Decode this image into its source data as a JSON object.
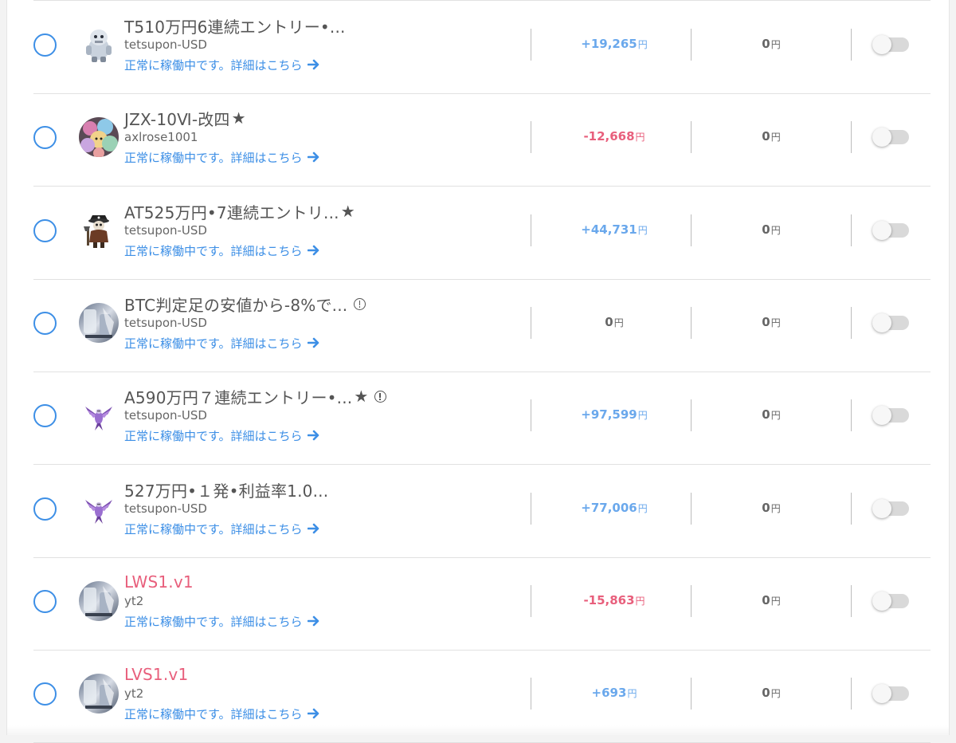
{
  "currency_unit": "円",
  "colors": {
    "accent_blue": "#3d8fe6",
    "profit_positive": "#6aa8ec",
    "profit_negative": "#e85f7c",
    "text_gray": "#555555"
  },
  "rows": [
    {
      "title": "T510万円6連続エントリー•...",
      "title_color": "gray",
      "star": false,
      "warning": false,
      "account": "tetsupon-USD",
      "status": "正常に稼働中です。詳細はこちら",
      "avatar_icon": "yeti-character-avatar",
      "profit": "+19,265",
      "profit_sign": "positive",
      "second_value": "0",
      "toggle_on": false
    },
    {
      "title": "JZX-10Ⅵ-改四",
      "title_color": "gray",
      "star": true,
      "warning": false,
      "account": "axlrose1001",
      "status": "正常に稼働中です。詳細はこちら",
      "avatar_icon": "plush-toys-photo-avatar",
      "profit": "-12,668",
      "profit_sign": "negative",
      "second_value": "0",
      "toggle_on": false
    },
    {
      "title": "AT525万円•7連続エントリ...",
      "title_color": "gray",
      "star": true,
      "warning": false,
      "account": "tetsupon-USD",
      "status": "正常に稼働中です。詳細はこちら",
      "avatar_icon": "pirate-skeleton-avatar",
      "profit": "+44,731",
      "profit_sign": "positive",
      "second_value": "0",
      "toggle_on": false
    },
    {
      "title": "BTC判定足の安値から-8%で...",
      "title_color": "gray",
      "star": false,
      "warning": true,
      "account": "tetsupon-USD",
      "status": "正常に稼働中です。詳細はこちら",
      "avatar_icon": "silver-device-photo-avatar",
      "profit": "0",
      "profit_sign": "zero",
      "second_value": "0",
      "toggle_on": false
    },
    {
      "title": "A590万円７連続エントリー•...",
      "title_color": "gray",
      "star": true,
      "warning": true,
      "account": "tetsupon-USD",
      "status": "正常に稼働中です。詳細はこちら",
      "avatar_icon": "purple-dragon-avatar",
      "profit": "+97,599",
      "profit_sign": "positive",
      "second_value": "0",
      "toggle_on": false
    },
    {
      "title": "527万円•１発•利益率1.0...",
      "title_color": "gray",
      "star": false,
      "warning": false,
      "account": "tetsupon-USD",
      "status": "正常に稼働中です。詳細はこちら",
      "avatar_icon": "purple-dragon-avatar",
      "profit": "+77,006",
      "profit_sign": "positive",
      "second_value": "0",
      "toggle_on": false
    },
    {
      "title": "LWS1.v1",
      "title_color": "pink",
      "star": false,
      "warning": false,
      "account": "yt2",
      "status": "正常に稼働中です。詳細はこちら",
      "avatar_icon": "silver-device-photo-avatar",
      "profit": "-15,863",
      "profit_sign": "negative",
      "second_value": "0",
      "toggle_on": false
    },
    {
      "title": "LVS1.v1",
      "title_color": "pink",
      "star": false,
      "warning": false,
      "account": "yt2",
      "status": "正常に稼働中です。詳細はこちら",
      "avatar_icon": "silver-device-photo-avatar",
      "profit": "+693",
      "profit_sign": "positive",
      "second_value": "0",
      "toggle_on": false
    }
  ]
}
